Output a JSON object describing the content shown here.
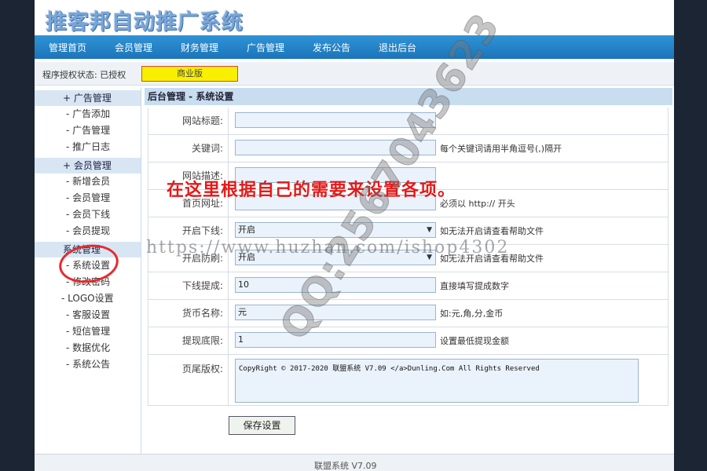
{
  "app": {
    "title": "推客邦自动推广系统"
  },
  "nav": {
    "items": [
      "管理首页",
      "会员管理",
      "财务管理",
      "广告管理",
      "发布公告",
      "退出后台"
    ]
  },
  "auth": {
    "label": "程序授权状态: 已授权",
    "badge": "商业版"
  },
  "sidebar": {
    "groups": [
      {
        "label": "+ 广告管理",
        "items": [
          "- 广告添加",
          "- 广告管理",
          "- 推广日志"
        ]
      },
      {
        "label": "+ 会员管理",
        "items": [
          "- 新增会员",
          "- 会员管理",
          "- 会员下线",
          "- 会员提现"
        ]
      },
      {
        "label": "系统管理",
        "items": [
          "- 系统设置",
          "- 修改密码"
        ]
      }
    ],
    "extra_items": [
      "- LOGO设置",
      "- 客服设置",
      "- 短信管理",
      "- 数据优化",
      "- 系统公告"
    ]
  },
  "main": {
    "title": "后台管理 - 系统设置",
    "fields": [
      {
        "label": "网站标题:",
        "value": "",
        "hint": ""
      },
      {
        "label": "关键词:",
        "value": "",
        "hint": "每个关键词请用半角逗号(,)隔开"
      },
      {
        "label": "网站描述:",
        "value": "",
        "hint": ""
      },
      {
        "label": "首页网址:",
        "value": "",
        "hint": "必须以 http:// 开头"
      },
      {
        "label": "开启下线:",
        "value": "开启",
        "hint": "如无法开启请查看帮助文件"
      },
      {
        "label": "开启防刷:",
        "value": "开启",
        "hint": "如无法开启请查看帮助文件"
      },
      {
        "label": "下线提成:",
        "value": "10",
        "hint": "直接填写提成数字"
      },
      {
        "label": "货币名称:",
        "value": "元",
        "hint": "如:元,角,分,金币"
      },
      {
        "label": "提现底限:",
        "value": "1",
        "hint": "设置最低提现金额"
      },
      {
        "label": "页尾版权:",
        "value": "CopyRight © 2017-2020 联盟系统 V7.09 </a>Dunling.Com All Rights Reserved",
        "hint": ""
      }
    ],
    "save_label": "保存设置"
  },
  "overlay": {
    "annotation": "在这里根据自己的需要来设置各项。",
    "watermark_url": "https://www.huzhan.com/ishop4302",
    "watermark_qq": "QQ:2567043623"
  },
  "footer": {
    "text": "联盟系统 V7.09"
  },
  "colors": {
    "nav": "#1c74b9",
    "badge": "#f8f000",
    "annotation": "#e31a1a",
    "circle": "#e52b2b"
  }
}
